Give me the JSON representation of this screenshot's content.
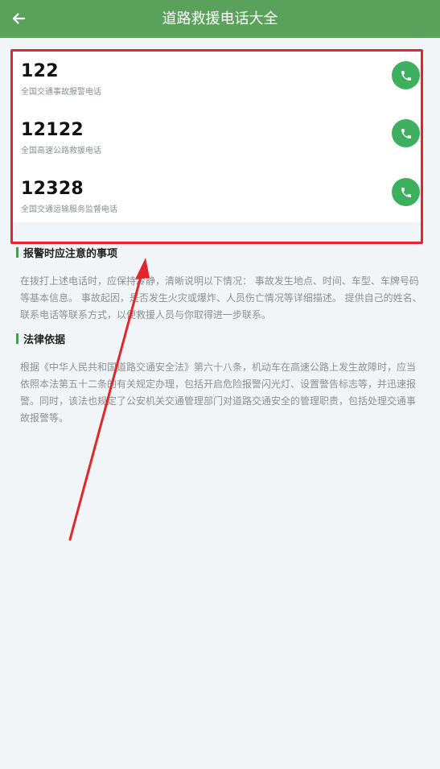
{
  "header": {
    "title": "道路救援电话大全",
    "back_icon": "arrow-left-icon",
    "bg_color": "#5aa25c"
  },
  "hotlines": [
    {
      "number": "122",
      "description": "全国交通事故报警电话",
      "action_icon": "phone-icon"
    },
    {
      "number": "12122",
      "description": "全国高速公路救援电话",
      "action_icon": "phone-icon"
    },
    {
      "number": "12328",
      "description": "全国交通运输服务监督电话",
      "action_icon": "phone-icon"
    }
  ],
  "sections": [
    {
      "heading": "报警时应注意的事项",
      "body": "在拨打上述电话时，应保持冷静，清晰说明以下情况： 事故发生地点、时间、车型、车牌号码等基本信息。 事故起因，是否发生火灾或爆炸、人员伤亡情况等详细描述。 提供自己的姓名、联系电话等联系方式，以便救援人员与你取得进一步联系。"
    },
    {
      "heading": "法律依据",
      "body": "根据《中华人民共和国道路交通安全法》第六十八条，机动车在高速公路上发生故障时，应当依照本法第五十二条的有关规定办理，包括开启危险报警闪光灯、设置警告标志等，并迅速报警。同时，该法也规定了公安机关交通管理部门对道路交通安全的管理职责，包括处理交通事故报警等。"
    }
  ],
  "colors": {
    "call_button": "#3db05f",
    "annotation": "#e3262b",
    "section_bar": "#4a9a55"
  }
}
